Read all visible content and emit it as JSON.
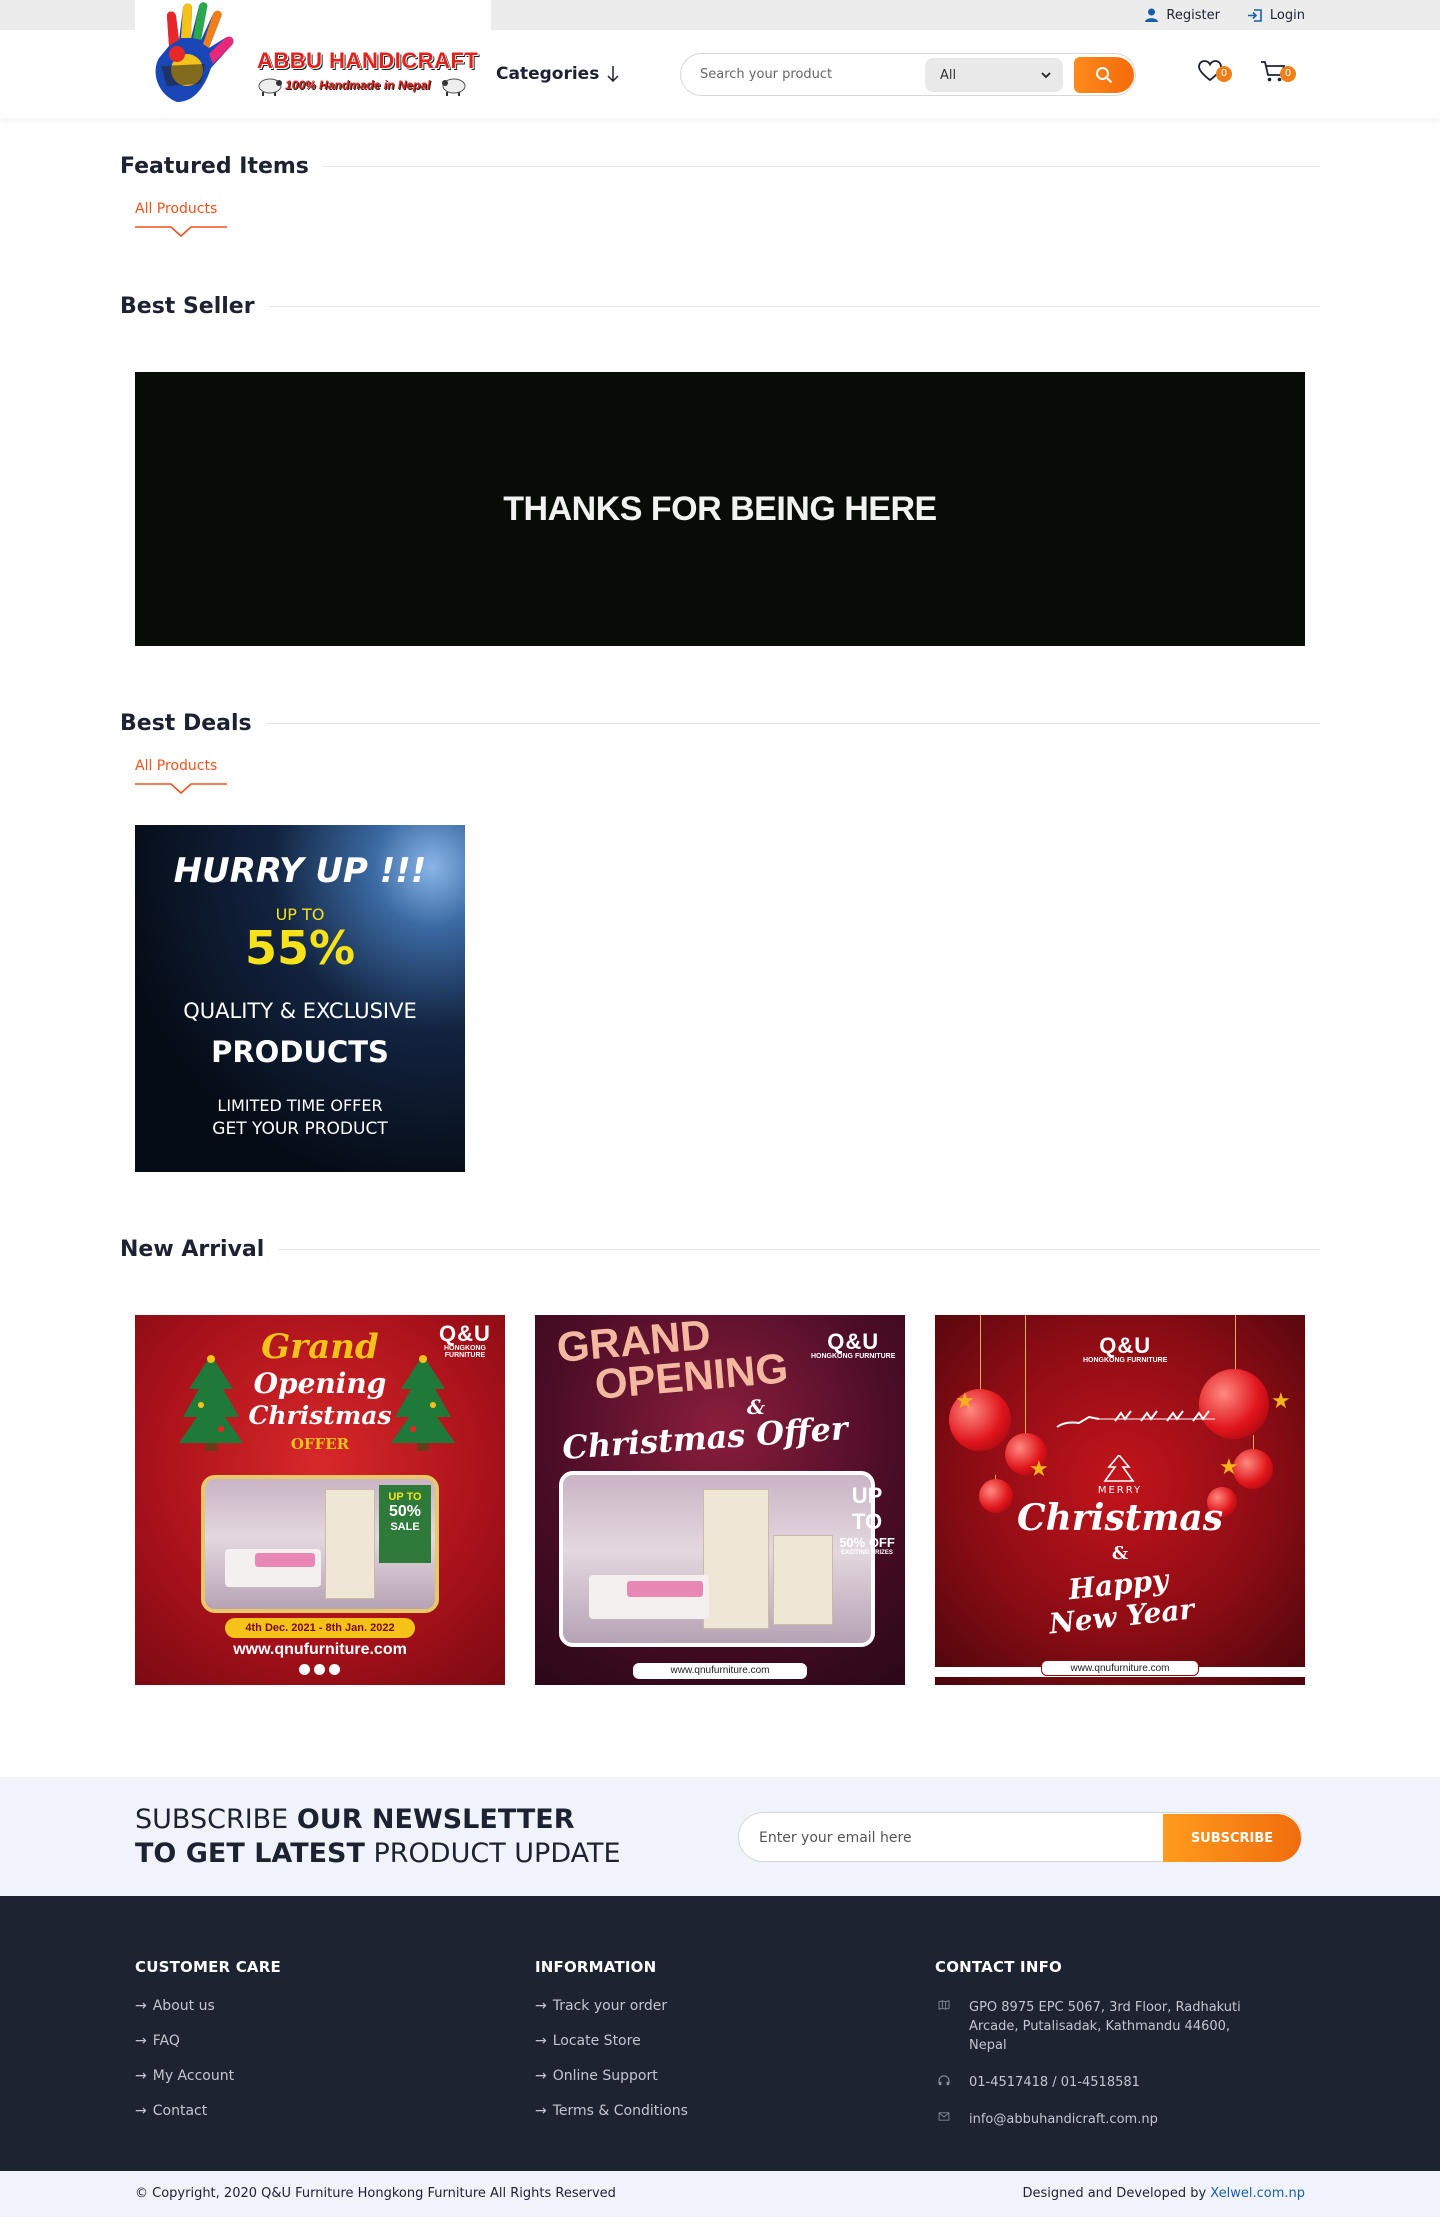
{
  "topbar": {
    "register_label": "Register",
    "login_label": "Login"
  },
  "logo": {
    "title": "ABBU HANDICRAFT",
    "tagline": "100% Handmade in Nepal"
  },
  "header": {
    "categories_label": "Categories",
    "search_placeholder": "Search your product",
    "category_selected": "All",
    "wishlist_count": "0",
    "cart_count": "0"
  },
  "sections": {
    "featured": {
      "title": "Featured Items",
      "tab": "All Products"
    },
    "best_seller": {
      "title": "Best Seller",
      "banner_text": "THANKS FOR BEING HERE"
    },
    "best_deals": {
      "title": "Best Deals",
      "tab": "All Products",
      "card": {
        "line1": "HURRY UP !!!",
        "line2": "UP TO",
        "line3": "55%",
        "line4": "QUALITY & EXCLUSIVE",
        "line5": "PRODUCTS",
        "line6": "LIMITED TIME OFFER",
        "line7": "GET YOUR PRODUCT"
      }
    },
    "new_arrival": {
      "title": "New Arrival",
      "items": [
        {
          "brand": "Q&U",
          "brand_sub": "HONGKONG FURNITURE",
          "headline_1": "Grand",
          "headline_2": "Opening",
          "headline_3": "Christmas",
          "headline_4": "OFFER",
          "sale_1": "UP TO",
          "sale_2": "50%",
          "sale_3": "SALE",
          "dates": "4th Dec. 2021 - 8th Jan. 2022",
          "url": "www.qnufurniture.com"
        },
        {
          "brand": "Q&U",
          "brand_sub": "HONGKONG FURNITURE",
          "headline_1": "GRAND",
          "headline_2": "OPENING",
          "headline_3": "&",
          "headline_4": "Christmas Offer",
          "sale_1": "UP TO",
          "sale_2": "50% OFF",
          "sale_3": "EXCITING PRIZES",
          "url": "www.qnufurniture.com"
        },
        {
          "brand": "Q&U",
          "brand_sub": "HONGKONG FURNITURE",
          "headline_1": "MERRY",
          "headline_2": "Christmas",
          "headline_3": "&",
          "headline_4": "Happy New Year",
          "url": "www.qnufurniture.com"
        }
      ]
    }
  },
  "newsletter": {
    "line1_light": "SUBSCRIBE ",
    "line1_bold": "OUR NEWSLETTER",
    "line2_bold": "TO GET LATEST",
    "line2_light": " PRODUCT UPDATE",
    "email_placeholder": "Enter your email here",
    "button_label": "SUBSCRIBE"
  },
  "footer": {
    "customer_care": {
      "title": "CUSTOMER CARE",
      "links": [
        "About us",
        "FAQ",
        "My Account",
        "Contact"
      ]
    },
    "information": {
      "title": "INFORMATION",
      "links": [
        "Track your order",
        "Locate Store",
        "Online Support",
        "Terms & Conditions"
      ]
    },
    "contact": {
      "title": "CONTACT INFO",
      "address": "GPO 8975 EPC 5067, 3rd Floor, Radhakuti Arcade, Putalisadak, Kathmandu 44600, Nepal",
      "phone": "01-4517418 / 01-4518581",
      "email": "info@abbuhandicraft.com.np"
    },
    "copyright": "© Copyright, 2020 Q&U Furniture Hongkong Furniture All Rights Reserved",
    "designed_by": "Designed and Developed by ",
    "developer": "Xelwel.com.np"
  },
  "colors": {
    "accent": "#f07f1a",
    "dark": "#1d2331",
    "text": "#1d2232",
    "link": "#f0521c"
  }
}
